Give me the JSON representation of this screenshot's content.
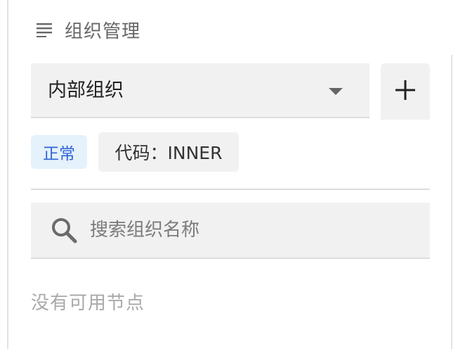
{
  "header": {
    "icon": "list-icon",
    "title": "组织管理"
  },
  "org_select": {
    "value": "内部组织",
    "icon": "caret-down-icon"
  },
  "add_button": {
    "icon": "plus-icon"
  },
  "badges": {
    "status": "正常",
    "code": "代码：INNER"
  },
  "search": {
    "icon": "search-icon",
    "placeholder": "搜索组织名称",
    "value": ""
  },
  "tree": {
    "empty_text": "没有可用节点"
  },
  "colors": {
    "status_badge_bg": "#e5f1fb",
    "status_badge_text": "#2f63d6",
    "field_bg": "#f1f1f1"
  }
}
